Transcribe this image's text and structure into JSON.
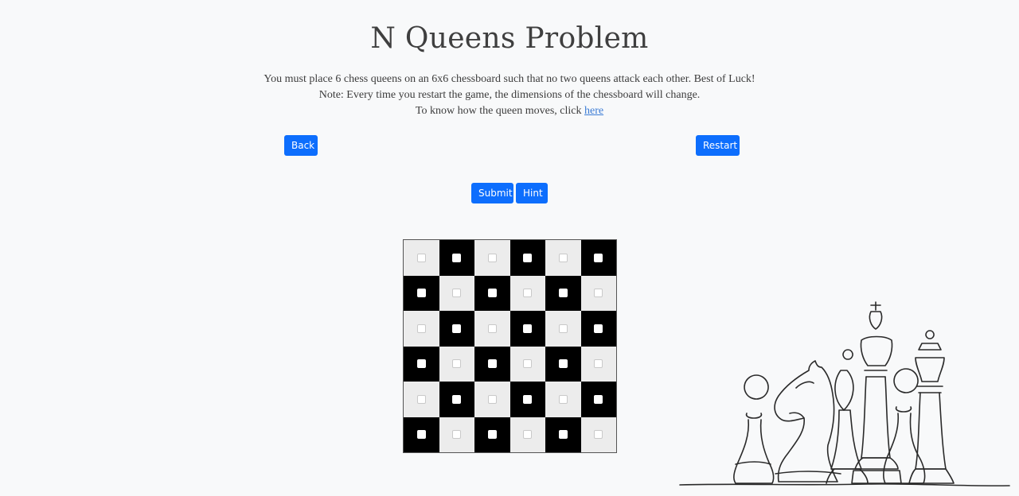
{
  "title": "N Queens Problem",
  "description": {
    "line1": "You must place 6 chess queens on an 6x6 chessboard such that no two queens attack each other. Best of Luck!",
    "line2": "Note: Every time you restart the game, the dimensions of the chessboard will change.",
    "line3_prefix": "To know how the queen moves, click ",
    "line3_link": "here"
  },
  "buttons": {
    "back": "Back",
    "restart": "Restart",
    "submit": "Submit",
    "hint": "Hint"
  },
  "board": {
    "size": 6,
    "light_color": "#ececec",
    "dark_color": "#000000",
    "queens_placed": []
  },
  "colors": {
    "accent": "#0d6efd",
    "background": "#f8f9fa"
  }
}
